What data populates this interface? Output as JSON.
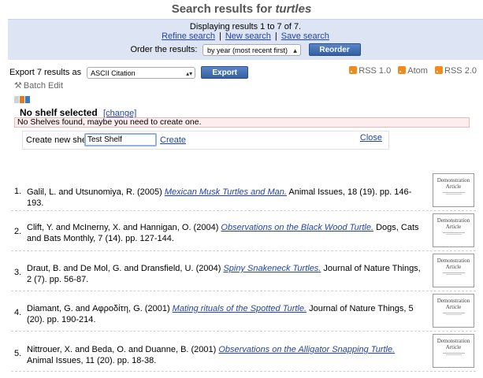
{
  "header": {
    "title_prefix": "Search results for",
    "query": "turtles"
  },
  "results_summary": {
    "displaying": "Displaying results 1 to 7 of 7.",
    "links": [
      "Refine search",
      "New search",
      "Save search"
    ],
    "separator": "|"
  },
  "order": {
    "label": "Order the results:",
    "selected": "by year (most recent first)",
    "button": "Reorder"
  },
  "export": {
    "label": "Export 7 results as",
    "selected": "ASCII Citation",
    "button": "Export"
  },
  "feeds": [
    "RSS 1.0",
    "Atom",
    "RSS 2.0"
  ],
  "batch_edit": "Batch Edit",
  "shelf": {
    "status": "No shelf selected",
    "change_link": "[change]",
    "message": "No Shelves found, maybe you need to create one.",
    "create_label": "Create new shelf:",
    "input_value": "Test Shelf",
    "create_link": "Create",
    "close_link": "Close"
  },
  "results": [
    {
      "num": "1.",
      "before": "Galil, L. and Utsunomiya, R. (2005) ",
      "title": "Mexican Musk Turtles and Man.",
      "after": " Animal Issues, 18 (19). pp. 146-193."
    },
    {
      "num": "2.",
      "before": "Clift, Y. and McInerny, X. and Hannigan, O. (2004) ",
      "title": "Observations on the Black Wood Turtle.",
      "after": " Dogs, Cats and Bats Monthly, 7 (14). pp. 127-144."
    },
    {
      "num": "3.",
      "before": "Draut, B. and De Mol, G. and Dransfield, U. (2004) ",
      "title": "Spiny Snakeneck Turtles.",
      "after": " Journal of Nature Things, 2 (7). pp. 56-87."
    },
    {
      "num": "4.",
      "before": "Diamant, G. and Αφροδίτη, G. (2001) ",
      "title": "Mating rituals of the Spotted Turtle.",
      "after": " Journal of Nature Things, 5 (20). pp. 190-214."
    },
    {
      "num": "5.",
      "before": "Nittrouer, X. and Beda, O. and Duanne, B. (2001) ",
      "title": "Observations on the Alligator Snapping Turtle.",
      "after": " Animal Issues, 11 (20). pp. 18-38."
    }
  ],
  "thumbnail": {
    "line1": "Demonstration",
    "line2": "Article"
  }
}
